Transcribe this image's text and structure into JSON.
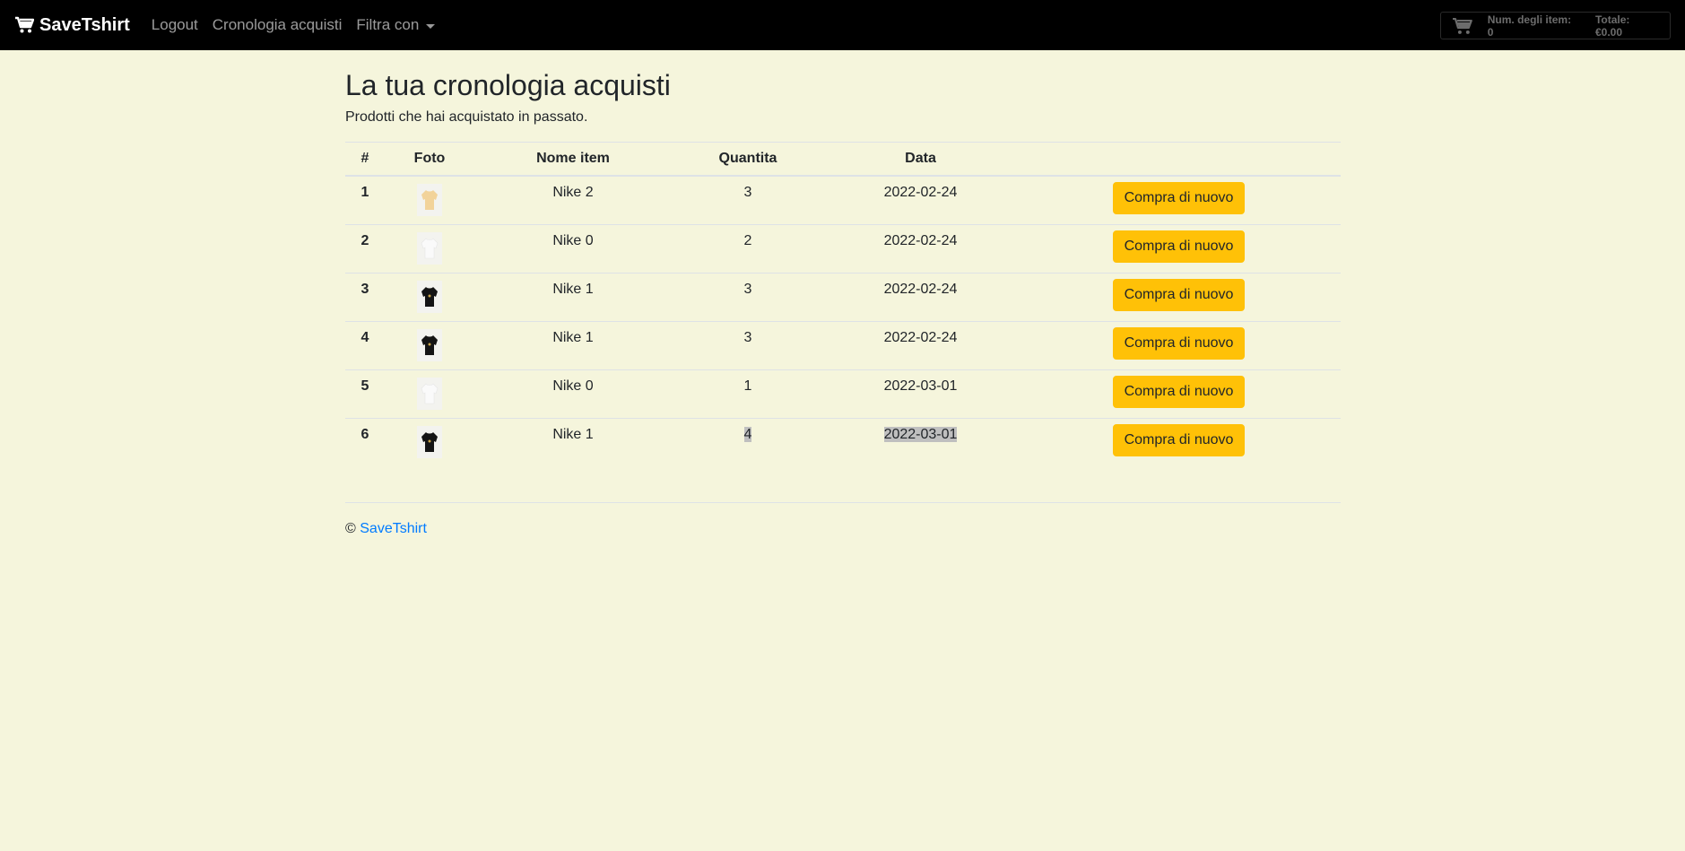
{
  "navbar": {
    "brand": "SaveTshirt",
    "links": [
      "Logout",
      "Cronologia acquisti"
    ],
    "dropdown_label": "Filtra con",
    "cart": {
      "items_label": "Num. degli item: 0",
      "total_label": "Totale: €0.00"
    }
  },
  "page": {
    "title": "La tua cronologia acquisti",
    "subtitle": "Prodotti che hai acquistato in passato."
  },
  "table": {
    "headers": [
      "#",
      "Foto",
      "Nome item",
      "Quantita",
      "Data",
      ""
    ],
    "rows": [
      {
        "idx": "1",
        "photo": "hoodie-beige-icon",
        "name": "Nike 2",
        "qty": "3",
        "date": "2022-02-24",
        "action": "Compra di nuovo"
      },
      {
        "idx": "2",
        "photo": "hoodie-white-icon",
        "name": "Nike 0",
        "qty": "2",
        "date": "2022-02-24",
        "action": "Compra di nuovo"
      },
      {
        "idx": "3",
        "photo": "hoodie-black-icon",
        "name": "Nike 1",
        "qty": "3",
        "date": "2022-02-24",
        "action": "Compra di nuovo"
      },
      {
        "idx": "4",
        "photo": "hoodie-black-icon",
        "name": "Nike 1",
        "qty": "3",
        "date": "2022-02-24",
        "action": "Compra di nuovo"
      },
      {
        "idx": "5",
        "photo": "hoodie-white-icon",
        "name": "Nike 0",
        "qty": "1",
        "date": "2022-03-01",
        "action": "Compra di nuovo"
      },
      {
        "idx": "6",
        "photo": "hoodie-black-icon",
        "name": "Nike 1",
        "qty": "4",
        "date": "2022-03-01",
        "action": "Compra di nuovo"
      }
    ]
  },
  "footer": {
    "copyright": "©",
    "link": "SaveTshirt"
  },
  "colors": {
    "background": "#f5f5dc",
    "navbar": "#000000",
    "button": "#ffc107",
    "link": "#007bff"
  }
}
